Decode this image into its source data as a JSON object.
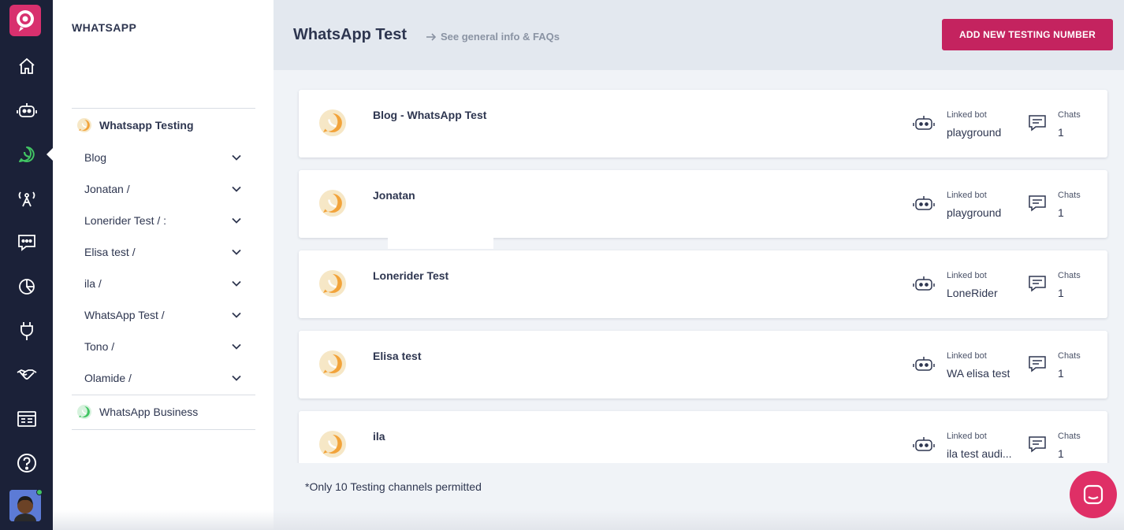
{
  "rail": {
    "items": [
      {
        "icon": "home-icon"
      },
      {
        "icon": "bot-icon"
      },
      {
        "icon": "whatsapp-icon",
        "active": true
      },
      {
        "icon": "broadcast-icon"
      },
      {
        "icon": "chat-icon"
      },
      {
        "icon": "analytics-icon"
      },
      {
        "icon": "plug-icon"
      },
      {
        "icon": "handshake-icon"
      },
      {
        "icon": "dashboard-icon"
      },
      {
        "icon": "help-icon"
      }
    ]
  },
  "sidebar": {
    "title": "WHATSAPP",
    "group_label": "Whatsapp Testing",
    "items": [
      {
        "label": "Blog"
      },
      {
        "label": "Jonatan /"
      },
      {
        "label": "Lonerider Test / :"
      },
      {
        "label": "Elisa test /"
      },
      {
        "label": "ila /"
      },
      {
        "label": "WhatsApp Test /"
      },
      {
        "label": "Tono /"
      },
      {
        "label": "Olamide /"
      }
    ],
    "business_label": "WhatsApp Business"
  },
  "header": {
    "title": "WhatsApp Test",
    "faq_link": "See general info & FAQs",
    "add_button": "ADD NEW TESTING NUMBER"
  },
  "cards": [
    {
      "name": "Blog - WhatsApp Test",
      "bot_label": "Linked bot",
      "bot": "playground",
      "chats_label": "Chats",
      "chats": "1"
    },
    {
      "name": "Jonatan",
      "bot_label": "Linked bot",
      "bot": "playground",
      "chats_label": "Chats",
      "chats": "1"
    },
    {
      "name": "Lonerider Test",
      "bot_label": "Linked bot",
      "bot": "LoneRider",
      "chats_label": "Chats",
      "chats": "1"
    },
    {
      "name": "Elisa test",
      "bot_label": "Linked bot",
      "bot": "WA elisa test",
      "chats_label": "Chats",
      "chats": "1"
    },
    {
      "name": "ila",
      "bot_label": "Linked bot",
      "bot": "ila test audi...",
      "chats_label": "Chats",
      "chats": "1"
    }
  ],
  "footnote": "*Only 10 Testing channels permitted",
  "colors": {
    "rail_bg": "#1b2138",
    "accent": "#c4235f",
    "whatsapp_green": "#41c463",
    "testing_orange": "#f2a33a"
  }
}
